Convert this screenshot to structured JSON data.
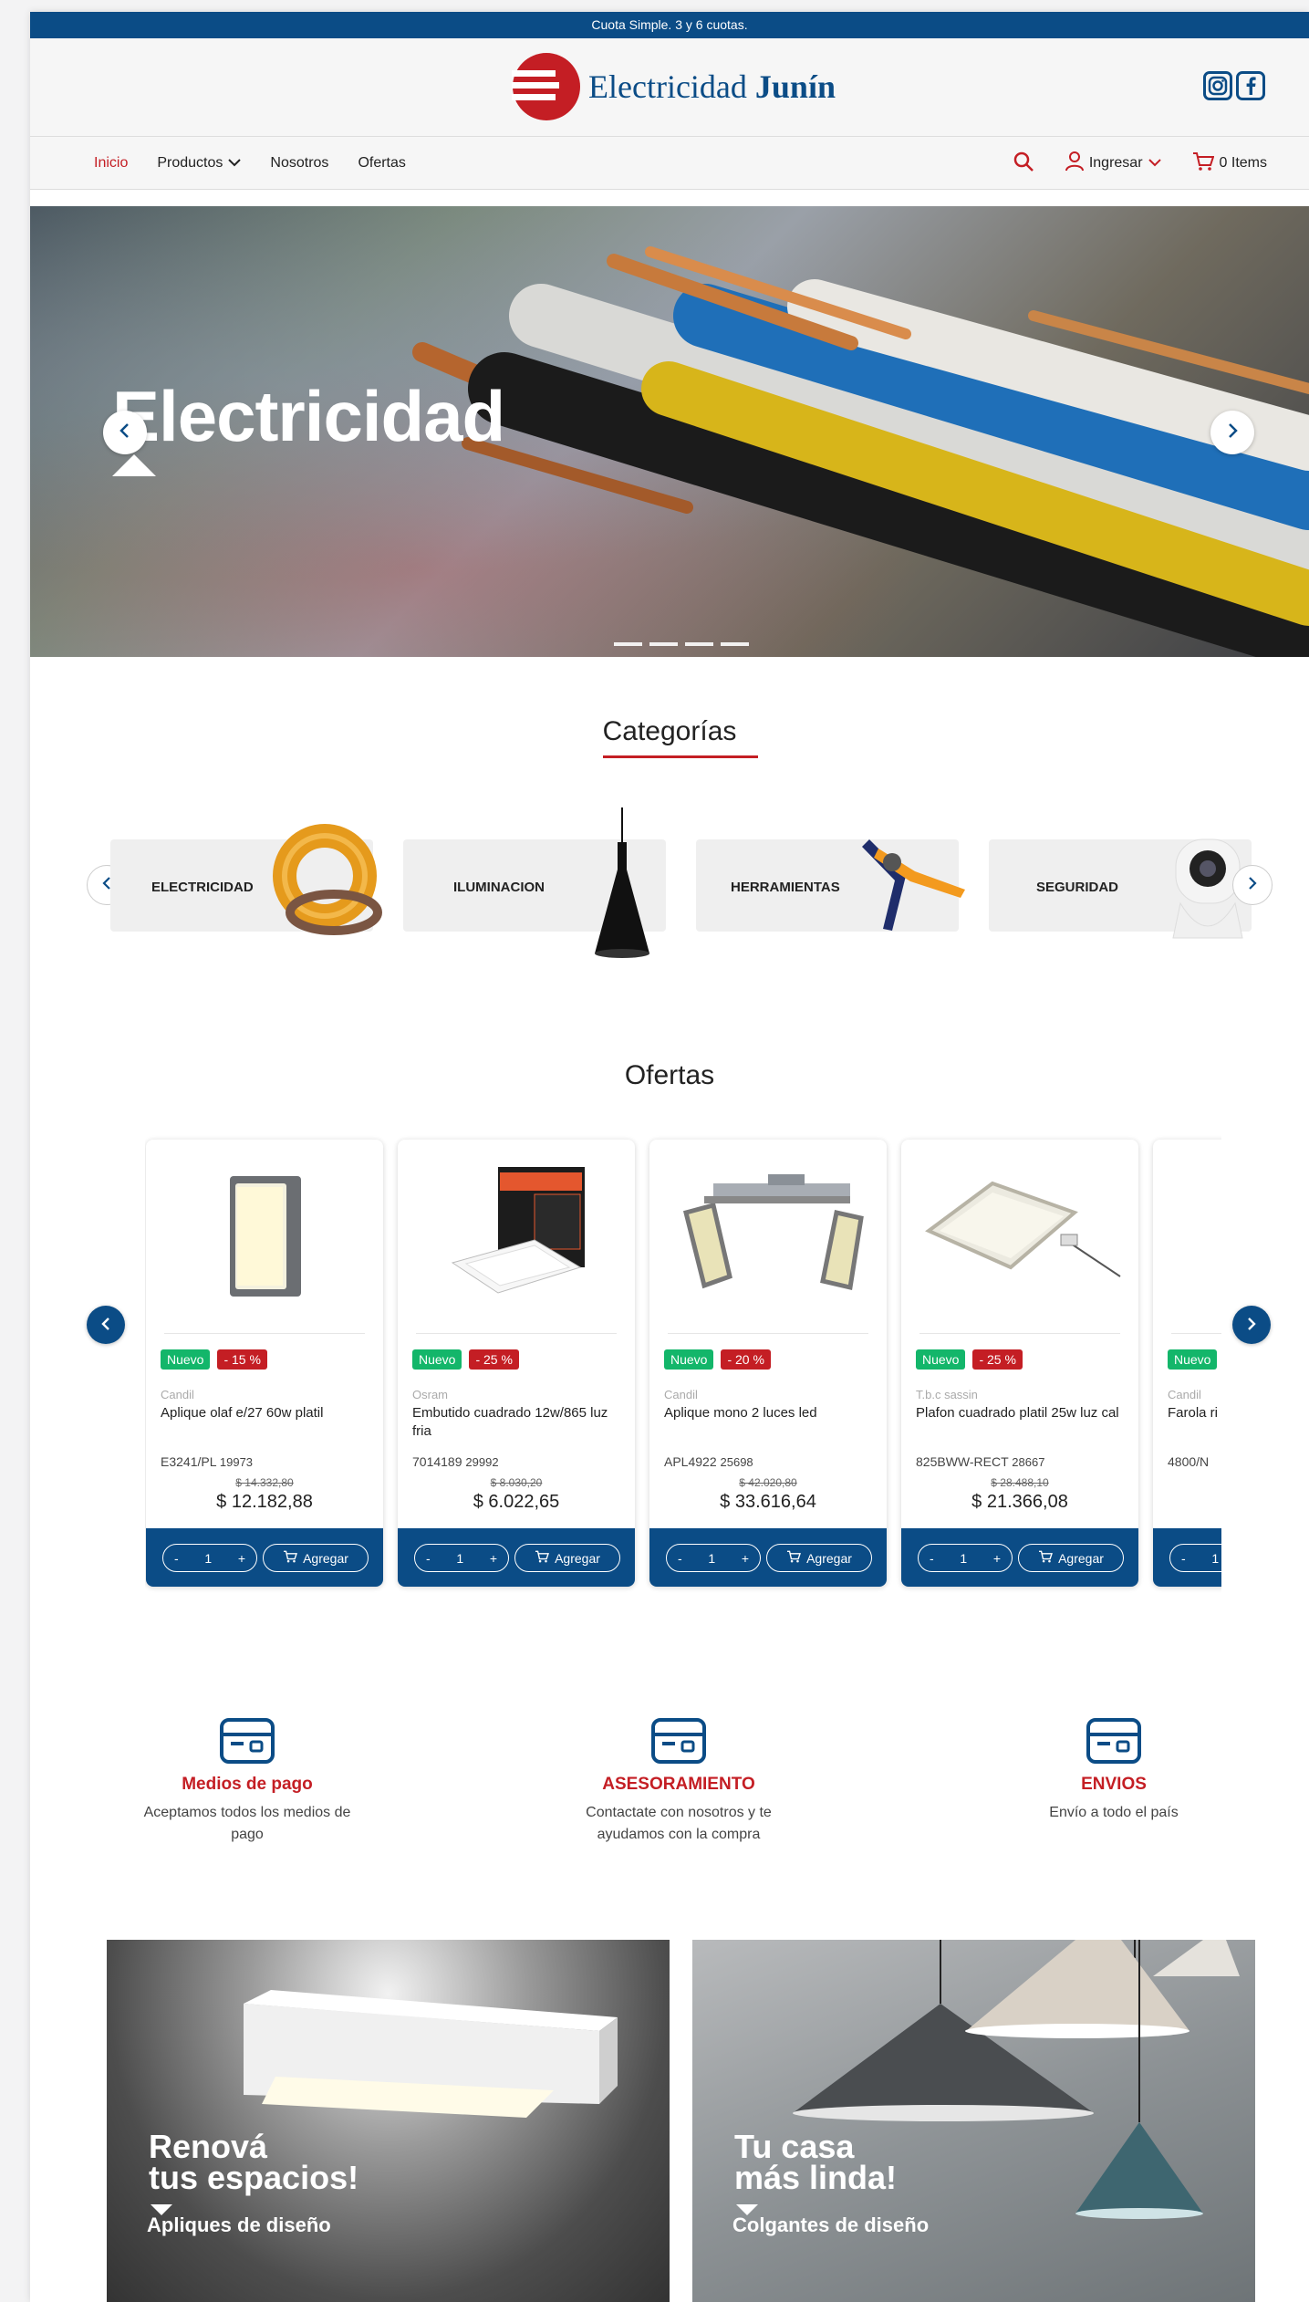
{
  "promo": "Cuota Simple. 3 y 6 cuotas.",
  "brand": {
    "name_light": "Electricidad",
    "name_bold": "Junín"
  },
  "socials": [
    {
      "icon": "instagram-icon"
    },
    {
      "icon": "facebook-icon"
    }
  ],
  "nav": {
    "items": [
      "Inicio",
      "Productos",
      "Nosotros",
      "Ofertas"
    ],
    "login": "Ingresar",
    "cart": "0 Items"
  },
  "hero": {
    "title": "Electricidad"
  },
  "categories": {
    "title": "Categorías",
    "items": [
      "ELECTRICIDAD",
      "ILUMINACION",
      "HERRAMIENTAS",
      "SEGURIDAD"
    ]
  },
  "offers": {
    "title": "Ofertas",
    "new_label": "Nuevo",
    "add_label": "Agregar",
    "qty": "1",
    "products": [
      {
        "discount": "- 15 %",
        "brand": "Candil",
        "name": "Aplique olaf e/27 60w platil",
        "sku": "E3241/PL",
        "code": "19973",
        "old_price": "$ 14.332,80",
        "price": "$ 12.182,88"
      },
      {
        "discount": "- 25 %",
        "brand": "Osram",
        "name": "Embutido cuadrado 12w/865 luz fria",
        "sku": "7014189",
        "code": "29992",
        "old_price": "$ 8.030,20",
        "price": "$ 6.022,65"
      },
      {
        "discount": "- 20 %",
        "brand": "Candil",
        "name": "Aplique mono 2 luces led",
        "sku": "APL4922",
        "code": "25698",
        "old_price": "$ 42.020,80",
        "price": "$ 33.616,64"
      },
      {
        "discount": "- 25 %",
        "brand": "T.b.c sassin",
        "name": "Plafon cuadrado platil 25w luz cal",
        "sku": "825BWW-RECT",
        "code": "28667",
        "old_price": "$ 28.488,10",
        "price": "$ 21.366,08"
      },
      {
        "brand": "Candil",
        "name": "Farola ri",
        "sku": "4800/N"
      }
    ]
  },
  "features": [
    {
      "title": "Medios de pago",
      "text": "Aceptamos todos los medios de pago"
    },
    {
      "title": "ASESORAMIENTO",
      "text": "Contactate con nosotros y te ayudamos con la compra"
    },
    {
      "title": "ENVIOS",
      "text": "Envío a todo el país"
    }
  ],
  "banners": [
    {
      "line1": "Renová",
      "line2": "tus espacios!",
      "sub": "Apliques de diseño"
    },
    {
      "line1": "Tu casa",
      "line2": "más linda!",
      "sub": "Colgantes de diseño"
    }
  ],
  "colors": {
    "primary_blue": "#0b4c86",
    "accent_red": "#c41e24",
    "badge_green": "#13b66a"
  }
}
